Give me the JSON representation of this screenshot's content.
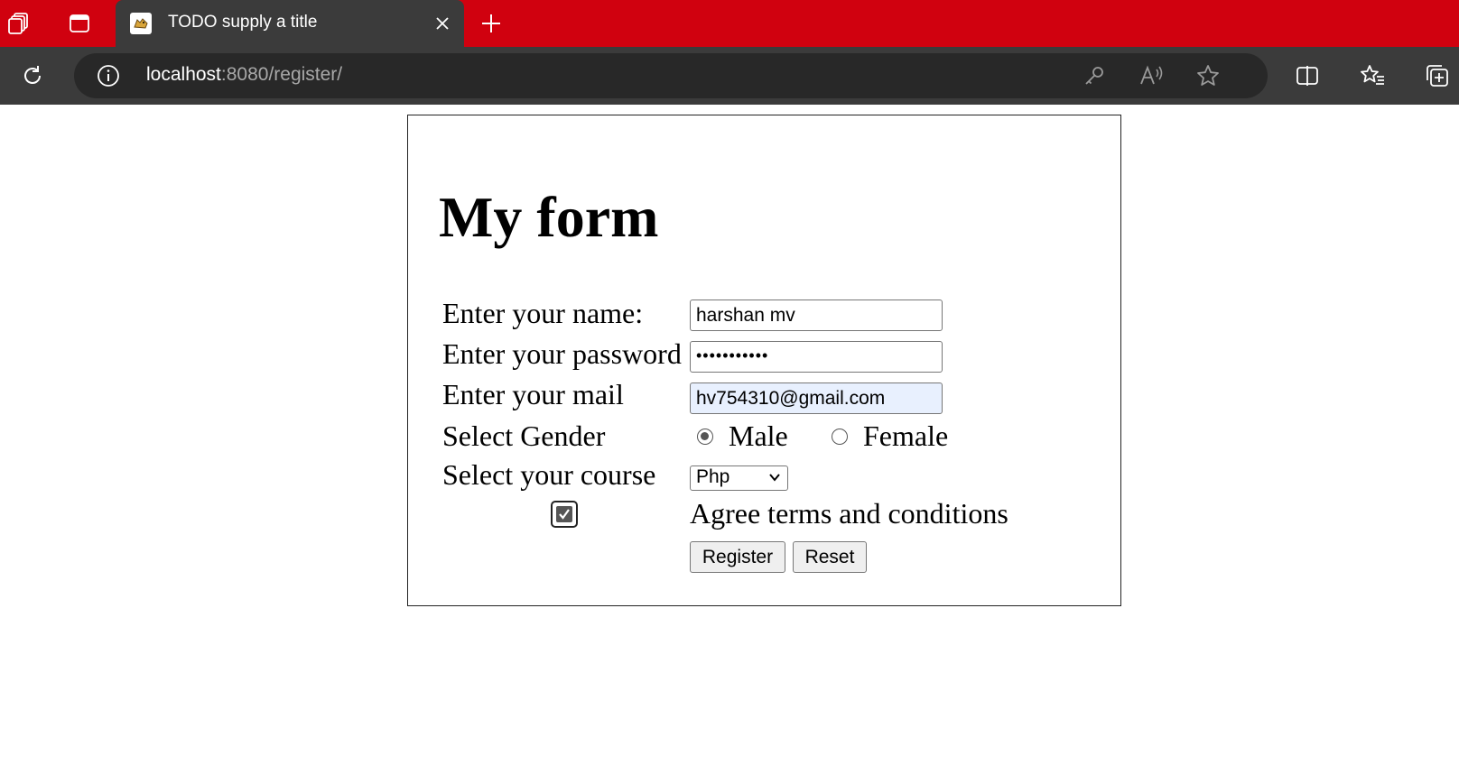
{
  "browser": {
    "tab": {
      "title": "TODO supply a title"
    },
    "address": {
      "host": "localhost",
      "rest": ":8080/register/"
    }
  },
  "icons": {
    "workspaces": "workspaces-icon",
    "tab_actions": "tab-actions-icon",
    "favicon": "tomcat-favicon-icon",
    "close": "close-icon",
    "new_tab": "plus-icon",
    "refresh": "refresh-icon",
    "info": "info-icon",
    "key": "key-icon",
    "read_aloud": "read-aloud-icon",
    "star": "star-icon",
    "split_screen": "split-screen-icon",
    "favorites": "favorites-icon",
    "collections": "collections-icon"
  },
  "colors": {
    "tabstrip": "#d0010f",
    "toolbar": "#3b3b3b",
    "urlbar": "#282828",
    "autofill": "#e8f0fe"
  },
  "form": {
    "heading": "My form",
    "name_label": "Enter your name:",
    "name_value": "harshan mv",
    "password_label": "Enter your password",
    "password_mask": "•••••••••••",
    "mail_label": "Enter your mail",
    "mail_value": "hv754310@gmail.com",
    "gender_label": "Select Gender",
    "gender_options": [
      "Male",
      "Female"
    ],
    "gender_selected": "Male",
    "course_label": "Select your course",
    "course_selected": "Php",
    "agree_label": "Agree terms and conditions",
    "agree_checked": true,
    "register_label": "Register",
    "reset_label": "Reset"
  }
}
